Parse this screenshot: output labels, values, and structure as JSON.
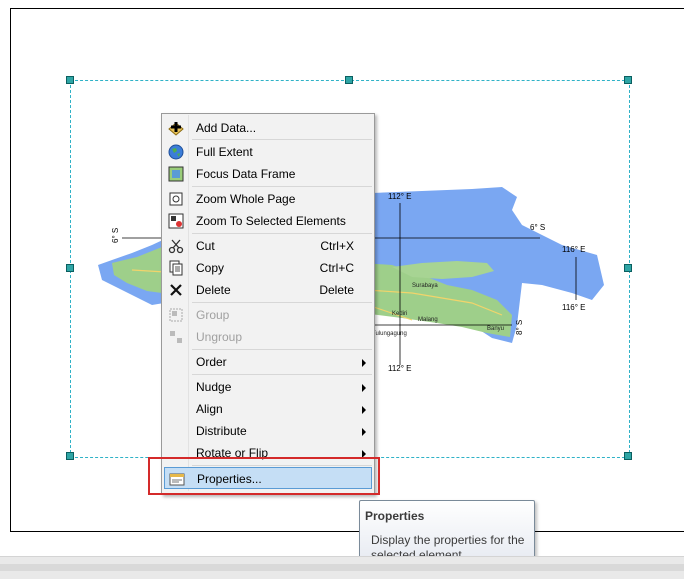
{
  "map": {
    "labels": {
      "lon_112_top": "112° E",
      "lon_112_bottom": "112° E",
      "lon_116_top": "116° E",
      "lon_116_bottom": "116° E",
      "lat_6_left": "6° S",
      "lat_6_right": "6° S",
      "lat_8_right": "8° S"
    },
    "cities": {
      "surabaya": "Surabaya",
      "kediri": "Kediri",
      "malang": "Malang",
      "banyuwangi": "Banyu",
      "tulungagung": "Tulungagung"
    },
    "colors": {
      "water": "#7aa7f2",
      "land": "#9ecf8a"
    }
  },
  "context_menu": {
    "items": [
      {
        "label": "Add Data...",
        "icon": "add-data-icon"
      },
      {
        "label": "Full Extent",
        "icon": "globe-icon"
      },
      {
        "label": "Focus Data Frame",
        "icon": "focus-frame-icon"
      },
      {
        "label": "Zoom Whole Page",
        "icon": "zoom-page-icon"
      },
      {
        "label": "Zoom To Selected Elements",
        "icon": "zoom-selected-icon"
      },
      {
        "label": "Cut",
        "shortcut": "Ctrl+X",
        "icon": "scissors-icon"
      },
      {
        "label": "Copy",
        "shortcut": "Ctrl+C",
        "icon": "copy-icon"
      },
      {
        "label": "Delete",
        "shortcut": "Delete",
        "icon": "delete-icon"
      },
      {
        "label": "Group",
        "icon": "group-icon"
      },
      {
        "label": "Ungroup",
        "icon": "ungroup-icon"
      },
      {
        "label": "Order"
      },
      {
        "label": "Nudge"
      },
      {
        "label": "Align"
      },
      {
        "label": "Distribute"
      },
      {
        "label": "Rotate or Flip"
      },
      {
        "label": "Properties...",
        "icon": "properties-icon"
      }
    ]
  },
  "tooltip": {
    "title": "Properties",
    "description": "Display the properties for the selected element"
  },
  "colors": {
    "selection": "#2fb2c7",
    "highlight_box": "#d42a2a",
    "menu_hover": "#c5def5"
  }
}
